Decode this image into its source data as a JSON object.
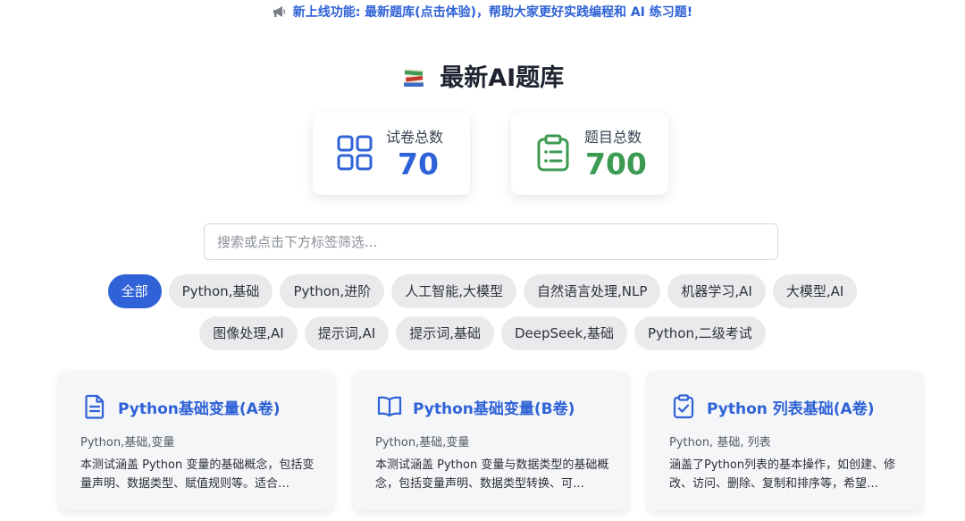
{
  "announcement": {
    "icon": "megaphone-icon",
    "text": "新上线功能: 最新题库(点击体验)，帮助大家更好实践编程和 AI 练习题!"
  },
  "page": {
    "title": "最新AI题库",
    "title_icon": "books-icon"
  },
  "stats": {
    "papers": {
      "label": "试卷总数",
      "value": "70",
      "icon": "grid-icon",
      "color": "#2f62d6"
    },
    "questions": {
      "label": "题目总数",
      "value": "700",
      "icon": "clipboard-list-icon",
      "color": "#3d9a52"
    }
  },
  "search": {
    "placeholder": "搜索或点击下方标签筛选...",
    "value": ""
  },
  "tags": {
    "row1": [
      "全部",
      "Python,基础",
      "Python,进阶",
      "人工智能,大模型",
      "自然语言处理,NLP",
      "机器学习,AI",
      "大模型,AI"
    ],
    "row2": [
      "图像处理,AI",
      "提示词,AI",
      "提示词,基础",
      "DeepSeek,基础",
      "Python,二级考试"
    ],
    "active": "全部"
  },
  "cards": [
    {
      "icon": "document-icon",
      "title": "Python基础变量(A卷)",
      "tags": "Python,基础,变量",
      "desc": "本测试涵盖 Python 变量的基础概念，包括变量声明、数据类型、赋值规则等。适合…"
    },
    {
      "icon": "open-book-icon",
      "title": "Python基础变量(B卷)",
      "tags": "Python,基础,变量",
      "desc": "本测试涵盖 Python 变量与数据类型的基础概念，包括变量声明、数据类型转换、可…"
    },
    {
      "icon": "clipboard-check-icon",
      "title": "Python 列表基础(A卷)",
      "tags": "Python, 基础, 列表",
      "desc": "涵盖了Python列表的基本操作，如创建、修改、访问、删除、复制和排序等，希望…"
    }
  ],
  "colors": {
    "accent": "#2f62d6",
    "success": "#3d9a52",
    "tag_bg": "#e9eaec",
    "card_bg": "#f5f6f8"
  }
}
